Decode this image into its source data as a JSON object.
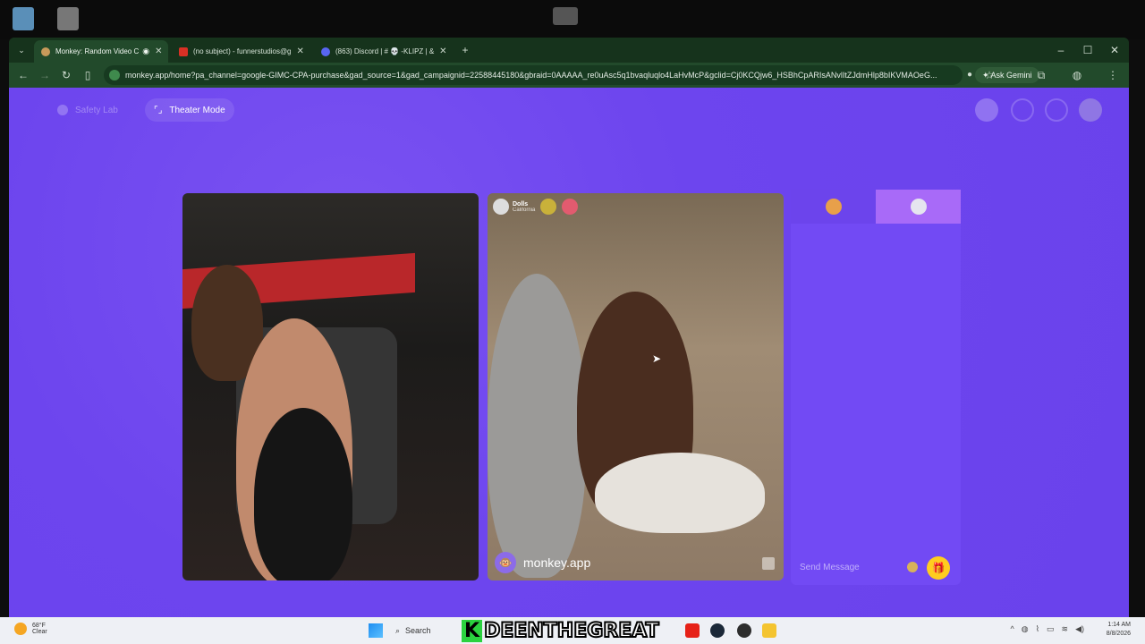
{
  "browser": {
    "tabs": [
      {
        "title": "Monkey: Random Video C",
        "active": true
      },
      {
        "title": "(no subject) - funnerstudios@g",
        "active": false
      },
      {
        "title": "(863) Discord | # 💀 -KLIPZ | &",
        "active": false
      }
    ],
    "new_tab": "+",
    "url": "monkey.app/home?pa_channel=google-GIMC-CPA-purchase&gad_source=1&gad_campaignid=22588445180&gbraid=0AAAAA_re0uAsc5q1bvaqluqlo4LaHvMcP&gclid=Cj0KCQjw6_HSBhCpARIsANvlItZJdmHlp8bIKVMAOeG...",
    "ask_gemini": "Ask Gemini",
    "window_controls": [
      "–",
      "☐",
      "✕"
    ]
  },
  "app": {
    "safety_lab": "Safety Lab",
    "theater_mode": "Theater Mode",
    "remote_user": {
      "name": "Dolls",
      "location": "California"
    },
    "watermark": "monkey.app",
    "chat": {
      "placeholder": "Send Message"
    }
  },
  "taskbar": {
    "weather": {
      "temp": "68°F",
      "condition": "Clear"
    },
    "search": "Search",
    "streamer_k": "K",
    "streamer_name": "DEENTHEGREAT",
    "time": "1:14 AM",
    "date": "8/8/2026"
  },
  "colors": {
    "page_bg": "#6a42ec",
    "active_chat_tab": "#a86af8",
    "gift_button": "#ffcd1f",
    "browser_frame": "#224a2b"
  }
}
